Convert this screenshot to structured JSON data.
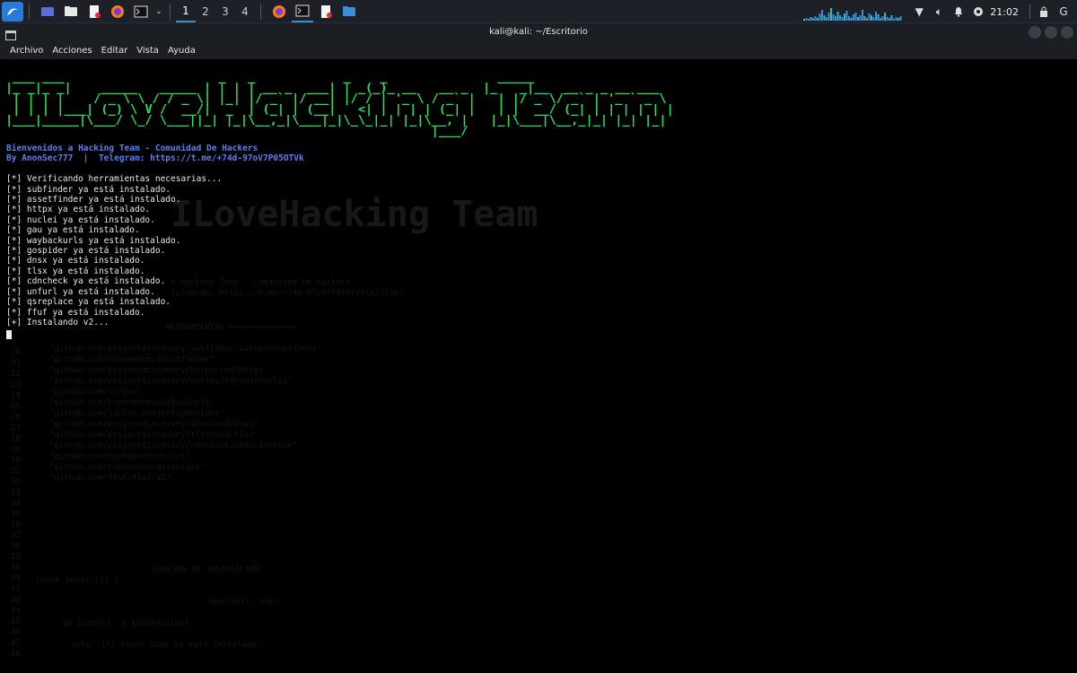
{
  "taskbar": {
    "workspaces": [
      "1",
      "2",
      "3",
      "4"
    ],
    "clock": "21:02",
    "user_initial": "G"
  },
  "window": {
    "title": "kali@kali: ~/Escritorio",
    "menu": [
      "Archivo",
      "Acciones",
      "Editar",
      "Vista",
      "Ayuda"
    ]
  },
  "terminal": {
    "banner_lines": [
      " ___ ___                     _   _            _    _               _____                    ",
      "|_ _|_ _|    _____   _____ | | | | __ _  ___| | _(_)_ __   __ _  |_   _|__  __ _ _ __ ___  ",
      " | | | |    / _ \\ \\ / / _ \\| |_| |/ _` |/ __| |/ / | '_ \\ / _` |   | |/ _ \\/ _` | '_ ` _ \\ ",
      " | | | |___| (_) \\ V /  __/|  _  | (_| | (__|   <| | | | | (_| |   | |  __/ (_| | | | | | |",
      "|___|_____|\\___/ \\_/ \\___||_| |_|\\__,_|\\___|_|\\_\\_|_| |_|\\__, |   |_|\\___|\\__,_|_| |_| |_|",
      "                                                          |___/                              "
    ],
    "welcome": "Bienvenidos a Hacking Team - Comunidad De Hackers",
    "byline": "By AnonSec777  |  Telegram: https://t.me/+74d-97oV7P05OTVk",
    "output_lines": [
      "[*] Verificando herramientas necesarias...",
      "[*] subfinder ya está instalado.",
      "[*] assetfinder ya está instalado.",
      "[*] httpx ya está instalado.",
      "[*] nuclei ya está instalado.",
      "[*] gau ya está instalado.",
      "[*] waybackurls ya está instalado.",
      "[*] gospider ya está instalado.",
      "[*] dnsx ya está instalado.",
      "[*] tlsx ya está instalado.",
      "[*] cdncheck ya está instalado.",
      "[*] unfurl ya está instalado.",
      "[*] qsreplace ya está instalado.",
      "[*] ffuf ya está instalado.",
      "[+] Instalando v2..."
    ],
    "ghost_lines": [
      "ILoveHacking Team",
      "a Hacking Team - Comunidad De Hackers\"",
      "Telegram: https://t.me/+74d-97oV7P05OTVk\\033[0m\"",
      "HERRAMIENTAS ==============",
      "\"github.com/projectdiscovery/subfinder/v2/cmd/subfinder\"",
      "\"github.com/tomnomnom/assetfinder\"",
      "\"github.com/projectdiscovery/httpx/cmd/httpx\"",
      "\"github.com/projectdiscovery/nuclei/v3/cmd/nuclei\"",
      "\"github.com/lc/gau\"",
      "\"github.com/tomnomnom/waybackurls\"",
      "\"github.com/jaeles-project/gospider\"",
      "\"github.com/projectdiscovery/dnsx/cmd/dnsx\"",
      "\"github.com/projectdiscovery/tlsx/cmd/tlsx\"",
      "\"github.com/projectdiscovery/cdncheck/cmd/cdncheck\"",
      "\"github.com/tomnomnom/unfurl\"",
      "\"github.com/tomnomnom/qsreplace\"",
      "\"github.com/ffuf/ffuf/v2\"",
      "FUNCIÓN DE INSTALACIÓN",
      "check_install() {",
      "/dev/null; then",
      "go install -v $tool@latest",
      "echo \"[*] $tool_name ya está instalado.\""
    ],
    "ghost_numbers": [
      "20",
      "21",
      "22",
      "23",
      "24",
      "25",
      "26",
      "27",
      "28",
      "29",
      "30",
      "31",
      "32",
      "33",
      "34",
      "35",
      "36",
      "37",
      "38",
      "39",
      "40",
      "41",
      "42",
      "43",
      "44",
      "45",
      "46",
      "47",
      "48"
    ]
  },
  "colors": {
    "banner": "#28e060",
    "blue_text": "#5f7df5",
    "taskbar_bg": "#1d2127",
    "accent": "#3a8fd8"
  }
}
